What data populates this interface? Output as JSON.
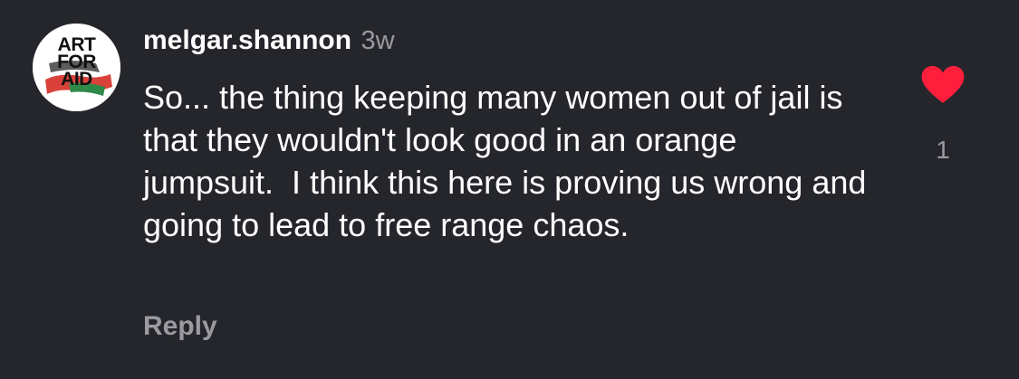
{
  "comment": {
    "avatar_text": {
      "line1": "ART",
      "line2": "FOR",
      "line3": "AID"
    },
    "username": "melgar.shannon",
    "time_ago": "3w",
    "body": "So... the thing keeping many women out of jail is that they wouldn't look good in an orange jumpsuit.  I think this here is proving us wrong and going to lead to free range chaos.",
    "reply_label": "Reply",
    "like_count": "1",
    "liked": true,
    "icons": {
      "like": "heart-icon"
    },
    "colors": {
      "background": "#25262b",
      "heart": "#ff1f3d",
      "muted_text": "#9a9ba1"
    }
  }
}
